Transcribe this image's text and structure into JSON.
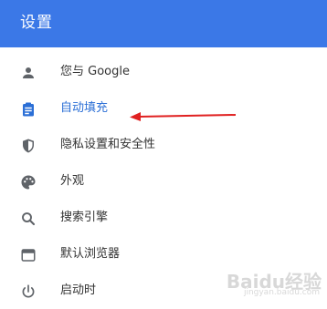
{
  "header": {
    "title": "设置"
  },
  "menu": {
    "items": [
      {
        "label": "您与 Google",
        "icon": "person-icon"
      },
      {
        "label": "自动填充",
        "icon": "clipboard-icon",
        "active": true
      },
      {
        "label": "隐私设置和安全性",
        "icon": "shield-icon"
      },
      {
        "label": "外观",
        "icon": "palette-icon"
      },
      {
        "label": "搜索引擎",
        "icon": "search-icon"
      },
      {
        "label": "默认浏览器",
        "icon": "browser-window-icon"
      },
      {
        "label": "启动时",
        "icon": "power-icon"
      }
    ]
  },
  "colors": {
    "header_bg": "#3b78e7",
    "active_text": "#2b6fd6",
    "active_icon": "#2b6fd6",
    "icon": "#5f6368",
    "annotation_arrow": "#e02020"
  },
  "watermark": {
    "brand": "Baidu",
    "text": "经验",
    "sub": "jingyan.baidu.com"
  }
}
